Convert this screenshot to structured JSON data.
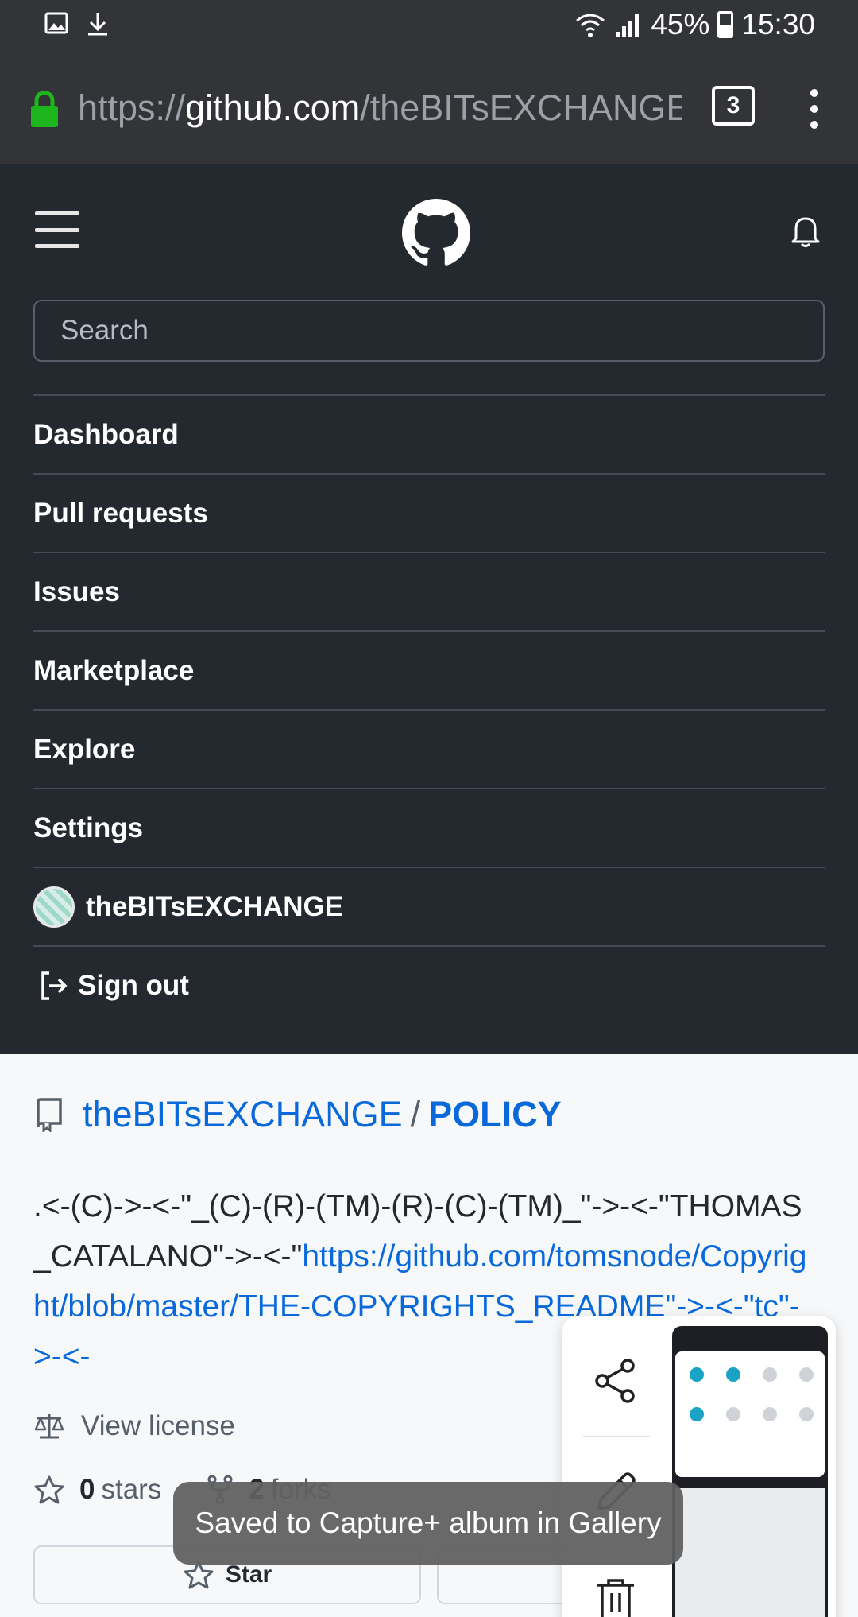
{
  "status_bar": {
    "battery": "45%",
    "time": "15:30"
  },
  "browser": {
    "url_scheme": "https://",
    "url_host": "github.com",
    "url_path": "/theBITsEXCHANGE",
    "tab_count": "3"
  },
  "github": {
    "search_placeholder": "Search",
    "menu": [
      "Dashboard",
      "Pull requests",
      "Issues",
      "Marketplace",
      "Explore",
      "Settings"
    ],
    "username": "theBITsEXCHANGE",
    "sign_out": "Sign out"
  },
  "repo": {
    "owner": "theBITsEXCHANGE",
    "separator": "/",
    "name": "POLICY",
    "description_text": ".<-(C)->-<-\"_(C)-(R)-(TM)-(R)-(C)-(TM)_\"->-<-\"THOMAS_CATALANO\"->-<-\"",
    "description_link": "https://github.com/tomsnode/Copyright/blob/master/THE-COPYRIGHTS_README\"->-<-\"tc\"->-<-",
    "license_link": "View license",
    "stars_count": "0",
    "stars_label": "stars",
    "forks_count": "2",
    "forks_label": "forks",
    "star_button": "Star"
  },
  "toast": {
    "message": "Saved to Capture+ album in Gallery"
  },
  "icons": [
    "image-icon",
    "download-icon",
    "wifi-icon",
    "signal-icon",
    "battery-icon",
    "lock-icon",
    "github-logo",
    "bell-icon",
    "repo-icon",
    "law-icon",
    "star-icon",
    "fork-icon",
    "share-icon",
    "pencil-icon",
    "trash-icon"
  ]
}
